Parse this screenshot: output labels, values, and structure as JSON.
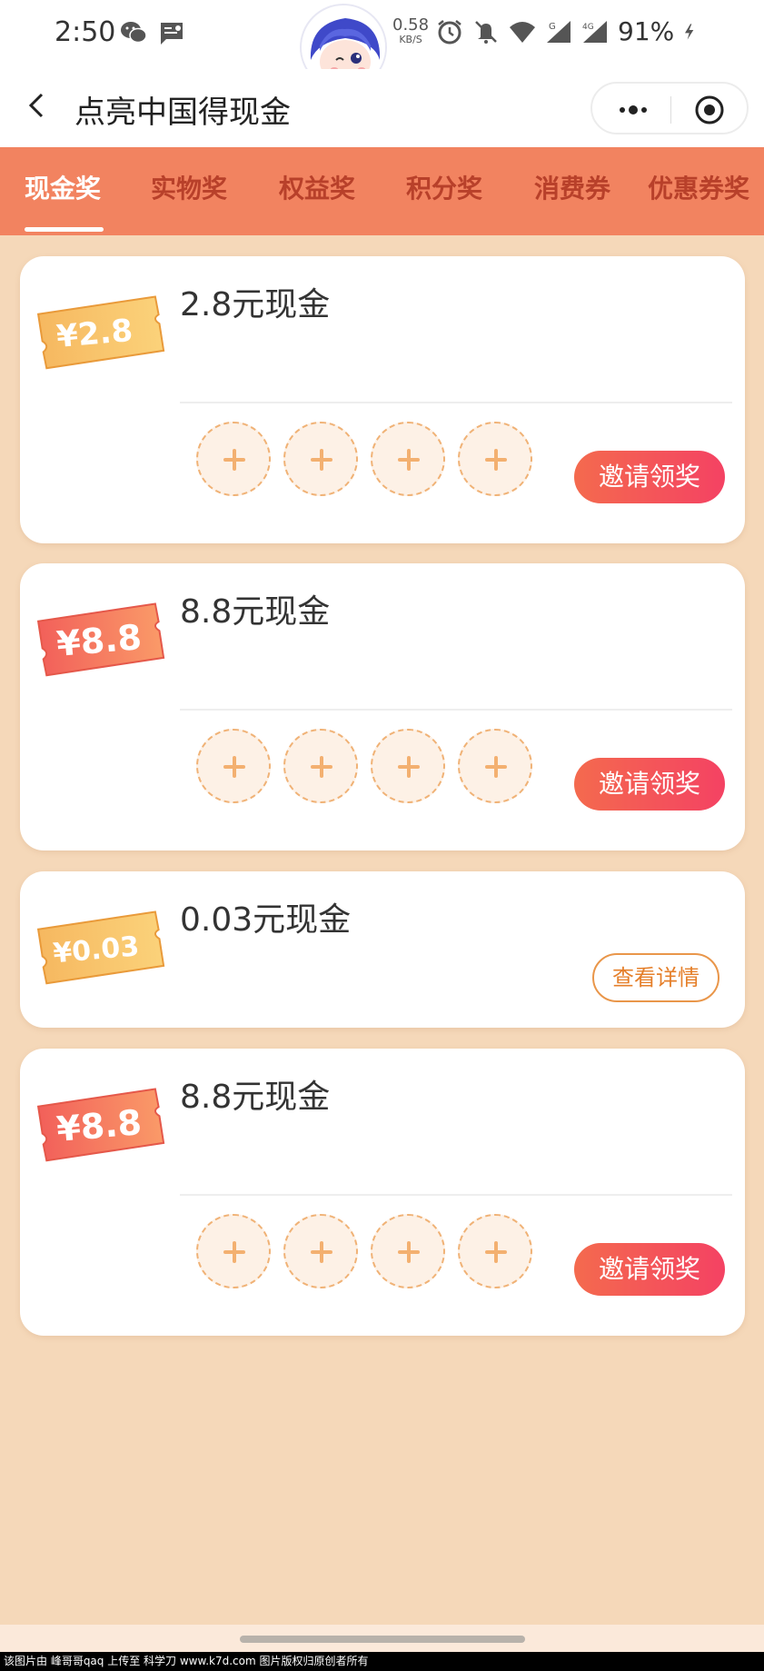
{
  "status_bar": {
    "time": "2:50",
    "speed_value": "0.58",
    "speed_unit": "KB/S",
    "battery": "91%",
    "icons": [
      "wechat-icon",
      "message-icon",
      "alarm-icon",
      "mute-icon",
      "wifi-icon",
      "signal-g-icon",
      "signal-4g-icon",
      "charging-icon"
    ]
  },
  "nav": {
    "title": "点亮中国得现金"
  },
  "tabs": [
    {
      "label": "现金奖",
      "active": true
    },
    {
      "label": "实物奖",
      "active": false
    },
    {
      "label": "权益奖",
      "active": false
    },
    {
      "label": "积分奖",
      "active": false
    },
    {
      "label": "消费券",
      "active": false
    },
    {
      "label": "优惠券奖",
      "active": false
    }
  ],
  "cards": [
    {
      "ticket": "¥2.8",
      "ticket_style": "gold",
      "title": "2.8元现金",
      "action": "邀请领奖",
      "slots": 4
    },
    {
      "ticket": "¥8.8",
      "ticket_style": "red",
      "title": "8.8元现金",
      "action": "邀请领奖",
      "slots": 4
    },
    {
      "ticket": "¥0.03",
      "ticket_style": "gold",
      "title": "0.03元现金",
      "action": "查看详情",
      "slots": 0
    },
    {
      "ticket": "¥8.8",
      "ticket_style": "red",
      "title": "8.8元现金",
      "action": "邀请领奖",
      "slots": 4
    }
  ],
  "colors": {
    "background": "#f5d8b9",
    "tab_bar": "#f28360",
    "button_gradient_start": "#f46a4e",
    "button_gradient_end": "#f44263"
  },
  "watermark": "该图片由 峰哥哥qaq 上传至 科学刀 www.k7d.com 图片版权归原创者所有"
}
